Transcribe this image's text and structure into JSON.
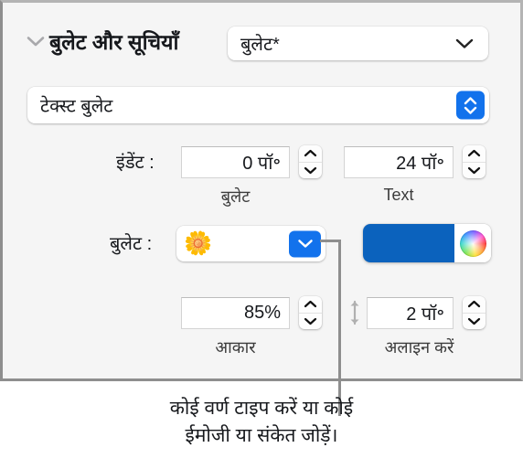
{
  "panel": {
    "title": "बुलेट और सूचियाँ",
    "disclosure_icon": "chevron-down-icon",
    "style_popup": {
      "value": "बुलेट*",
      "chevron_icon": "chevron-down-icon"
    },
    "bullet_type_popup": {
      "value": "टेक्स्ट बुलेट",
      "stepper_icon": "chevron-up-down-icon"
    },
    "indent": {
      "label": "इंडेंट :",
      "bullet_value": "0 पॉ॰",
      "bullet_sub_label": "बुलेट",
      "text_value": "24 पॉ॰",
      "text_sub_label": "Text"
    },
    "bullet": {
      "label": "बुलेट :",
      "glyph": "🌼",
      "dropdown_icon": "chevron-down-icon",
      "color_swatch": "#0b62bd",
      "color_wheel_icon": "color-wheel-icon"
    },
    "size": {
      "value": "85%",
      "sub_label": "आकार"
    },
    "align": {
      "arrow_icon": "arrows-up-down-icon",
      "value": "2 पॉ॰",
      "sub_label": "अलाइन करें"
    }
  },
  "caption": {
    "line1": "कोई वर्ण टाइप करें या कोई",
    "line2": "ईमोजी या संकेत जोड़ें।"
  },
  "colors": {
    "accent_blue": "#1272ec",
    "swatch_blue": "#0b62bd",
    "panel_bg": "#f5f5f5",
    "border_gray": "#8e8e8e"
  }
}
